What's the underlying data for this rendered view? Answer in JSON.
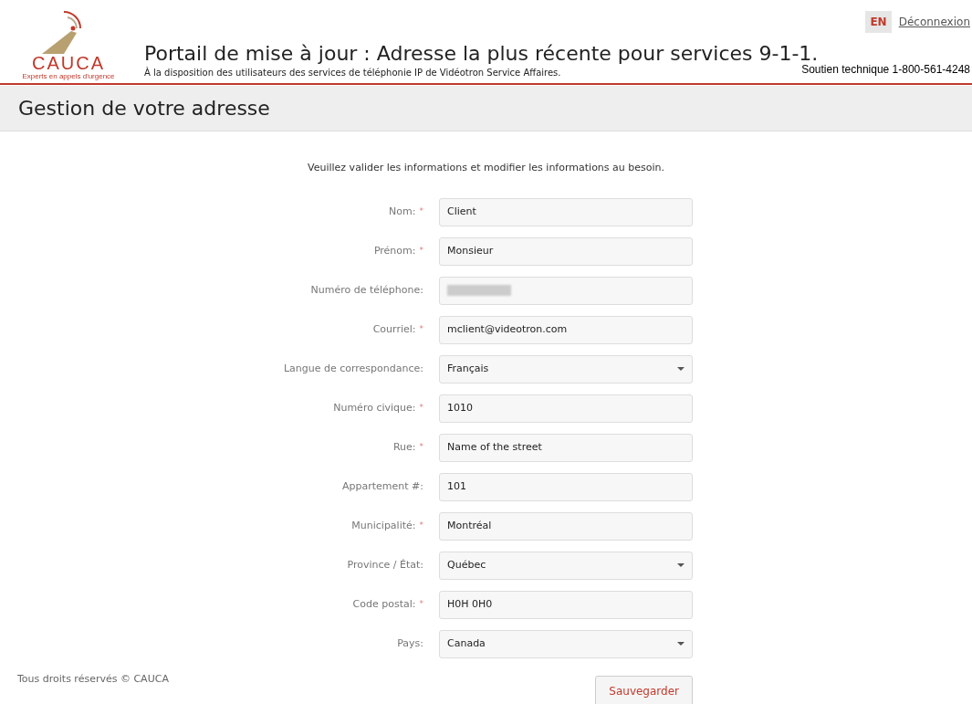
{
  "logo": {
    "name": "CAUCA",
    "tagline": "Experts en appels d'urgence"
  },
  "header": {
    "title": "Portail de mise à jour : Adresse la plus récente pour services 9-1-1.",
    "subtitle": "À la disposition des utilisateurs des services de téléphonie IP de Vidéotron Service Affaires.",
    "support": "Soutien technique 1-800-561-4248",
    "language_button": "EN",
    "logout_link": "Déconnexion"
  },
  "section_title": "Gestion de votre adresse",
  "instructions": "Veuillez valider les informations et modifier les informations au besoin.",
  "fields": [
    {
      "label": "Nom:",
      "required_mark": "*",
      "kind": "text",
      "value": "Client"
    },
    {
      "label": "Prénom:",
      "required_mark": "*",
      "kind": "text",
      "value": "Monsieur"
    },
    {
      "label": "Numéro de téléphone:",
      "kind": "redacted"
    },
    {
      "label": "Courriel:",
      "required_mark": "*",
      "kind": "text",
      "value": "mclient@videotron.com"
    },
    {
      "label": "Langue de correspondance:",
      "kind": "select",
      "value": "Français"
    },
    {
      "label": "Numéro civique:",
      "required_mark": "*",
      "kind": "text",
      "value": "1010"
    },
    {
      "label": "Rue:",
      "required_mark": "*",
      "kind": "text",
      "value": "Name of the street"
    },
    {
      "label": "Appartement #:",
      "kind": "text",
      "value": "101"
    },
    {
      "label": "Municipalité:",
      "required_mark": "*",
      "kind": "text",
      "value": "Montréal"
    },
    {
      "label": "Province / État:",
      "kind": "select",
      "value": "Québec"
    },
    {
      "label": "Code postal:",
      "required_mark": "*",
      "kind": "text",
      "value": "H0H 0H0"
    },
    {
      "label": "Pays:",
      "kind": "select",
      "value": "Canada"
    }
  ],
  "save_button": "Sauvegarder",
  "footer": "Tous droits réservés © CAUCA"
}
